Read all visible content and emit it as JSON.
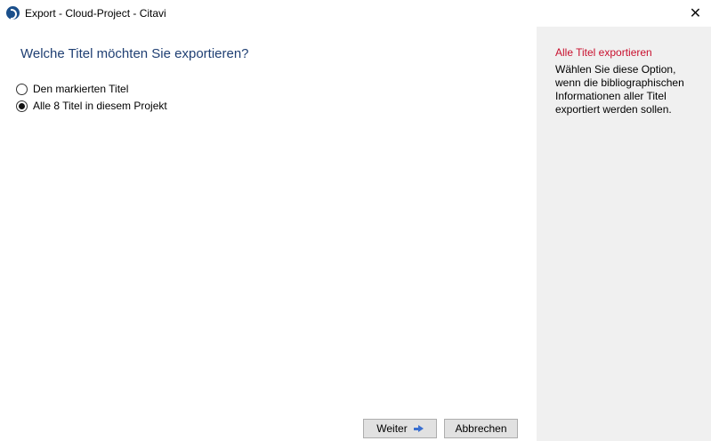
{
  "window": {
    "title": "Export - Cloud-Project - Citavi",
    "close_symbol": "✕",
    "app_icon": "citavi-logo-icon",
    "close_icon": "close-icon"
  },
  "main": {
    "question": "Welche Titel möchten Sie exportieren?",
    "options": [
      {
        "label": "Den markierten Titel",
        "selected": false
      },
      {
        "label": "Alle 8 Titel in diesem Projekt",
        "selected": true
      }
    ]
  },
  "buttons": {
    "next_label": "Weiter",
    "next_icon": "arrow-right-icon",
    "cancel_label": "Abbrechen"
  },
  "help": {
    "title": "Alle Titel exportieren",
    "text": "Wählen Sie diese Option, wenn die bibliographischen Informationen aller Titel exportiert werden sollen."
  },
  "colors": {
    "question_text": "#1f3f73",
    "help_title": "#c8102e",
    "help_panel_bg": "#f0f0f0",
    "button_bg": "#e1e1e1",
    "arrow": "#3a6fd0"
  }
}
